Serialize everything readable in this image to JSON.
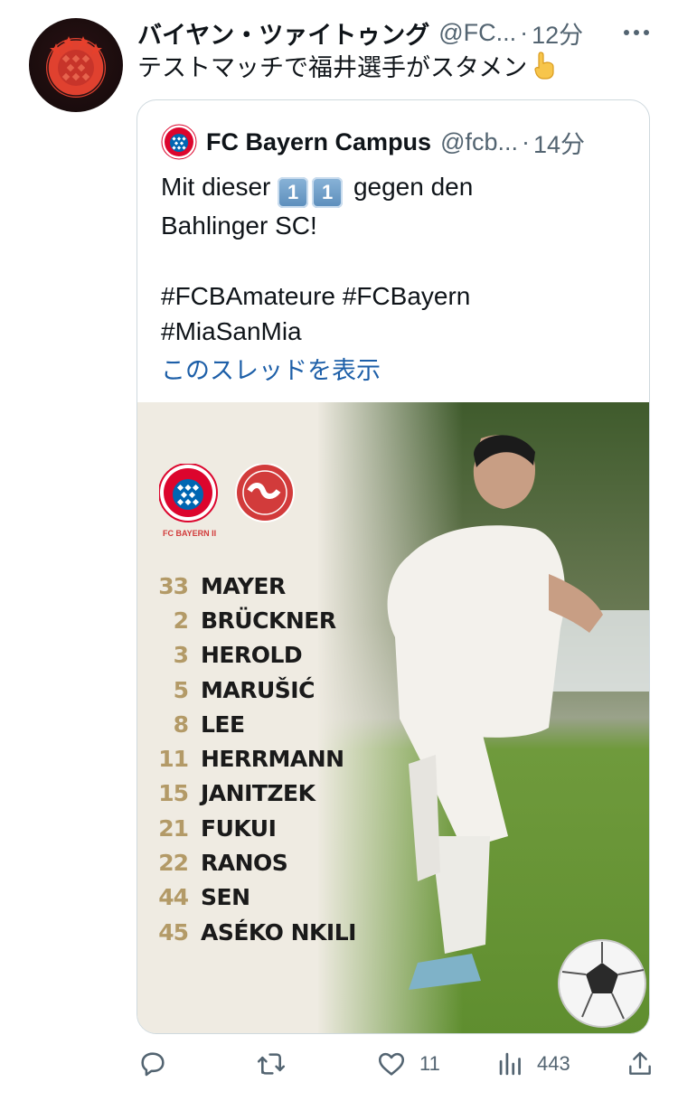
{
  "author": {
    "display_name": "バイヤン・ツァイトゥング",
    "handle": "@FC...",
    "separator": "·",
    "time": "12分",
    "avatar_icon": "fc-bayern-crest-icon",
    "text": "テストマッチで福井選手がスタメン"
  },
  "quoted": {
    "display_name": "FC Bayern Campus",
    "handle": "@fcb...",
    "separator": "·",
    "time": "14分",
    "text_line1_after": "gegen den",
    "text_line1_before": "Mit dieser",
    "keycaps": [
      "1",
      "1"
    ],
    "text_line2": "Bahlinger SC!",
    "hashtags_line1": "#FCBAmateure #FCBayern",
    "hashtags_line2": "#MiaSanMia",
    "show_thread": "このスレッドを表示"
  },
  "media": {
    "team_caption": "FC BAYERN II",
    "lineup": [
      {
        "number": "33",
        "name": "MAYER"
      },
      {
        "number": "2",
        "name": "BRÜCKNER"
      },
      {
        "number": "3",
        "name": "HEROLD"
      },
      {
        "number": "5",
        "name": "MARUŠIĆ"
      },
      {
        "number": "8",
        "name": "LEE"
      },
      {
        "number": "11",
        "name": "HERRMANN"
      },
      {
        "number": "15",
        "name": "JANITZEK"
      },
      {
        "number": "21",
        "name": "FUKUI"
      },
      {
        "number": "22",
        "name": "RANOS"
      },
      {
        "number": "44",
        "name": "SEN"
      },
      {
        "number": "45",
        "name": "ASÉKO NKILI"
      }
    ]
  },
  "actions": {
    "reply_icon": "reply-icon",
    "retweet_icon": "retweet-icon",
    "like_icon": "heart-icon",
    "like_count": "11",
    "views_icon": "views-icon",
    "views_count": "443",
    "share_icon": "share-icon"
  },
  "colors": {
    "text": "#0f1419",
    "secondary": "#536471",
    "link": "#1d5fa8",
    "border": "#cfd9de",
    "lineup_number_gold": "#b39a67",
    "bayern_red": "#dc052d"
  }
}
